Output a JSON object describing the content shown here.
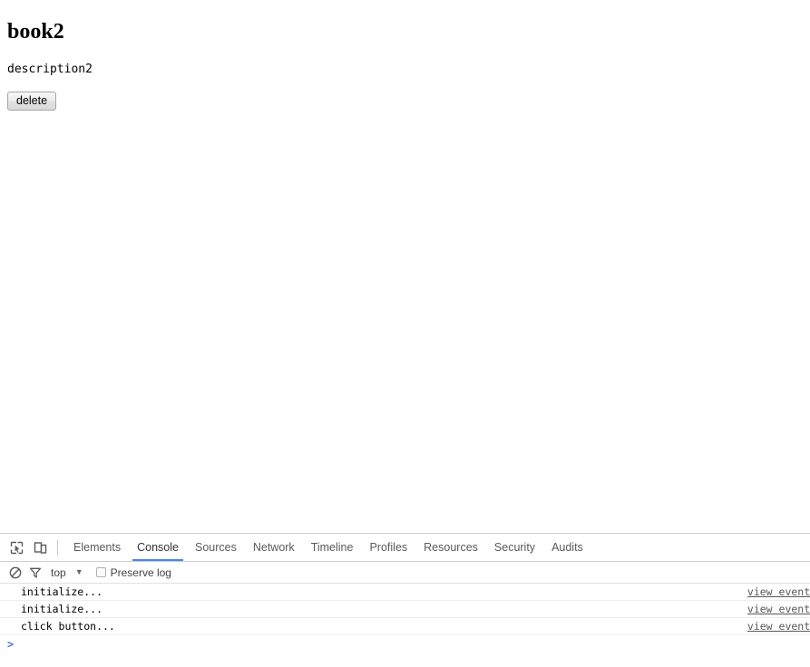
{
  "page": {
    "title": "book2",
    "description": "description2",
    "delete_label": "delete"
  },
  "devtools": {
    "toolbar_icons": [
      {
        "name": "inspect-element-icon",
        "label": "Inspect element"
      },
      {
        "name": "device-toolbar-icon",
        "label": "Toggle device toolbar"
      }
    ],
    "tabs": [
      {
        "label": "Elements",
        "active": false
      },
      {
        "label": "Console",
        "active": true
      },
      {
        "label": "Sources",
        "active": false
      },
      {
        "label": "Network",
        "active": false
      },
      {
        "label": "Timeline",
        "active": false
      },
      {
        "label": "Profiles",
        "active": false
      },
      {
        "label": "Resources",
        "active": false
      },
      {
        "label": "Security",
        "active": false
      },
      {
        "label": "Audits",
        "active": false
      }
    ],
    "active_tab_underline_color": "#4285f4",
    "options_bar": {
      "clear_icon": "clear-console-icon",
      "filter_icon": "filter-icon",
      "context": "top",
      "context_caret": "▼",
      "preserve_log_label": "Preserve log",
      "preserve_log_checked": false
    },
    "console": {
      "messages": [
        {
          "text": "initialize...",
          "source": "view event.h"
        },
        {
          "text": "initialize...",
          "source": "view event.h"
        },
        {
          "text": "click button...",
          "source": "view event.h"
        }
      ],
      "prompt": ">"
    }
  }
}
